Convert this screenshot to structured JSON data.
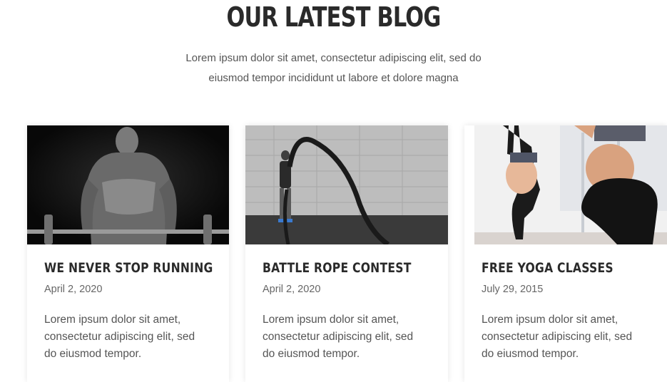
{
  "section": {
    "title": "OUR LATEST BLOG",
    "intro_lines": [
      "Lorem ipsum dolor sit amet, consectetur adipiscing elit, sed do",
      "eiusmod tempor incididunt ut labore et dolore magna"
    ]
  },
  "posts": [
    {
      "title": "WE NEVER STOP RUNNING",
      "date": "April 2, 2020",
      "excerpt_lines": [
        "Lorem ipsum dolor sit amet,",
        "consectetur adipiscing elit, sed",
        "do eiusmod tempor."
      ],
      "image": "bodybuilder-barbell-photo"
    },
    {
      "title": "BATTLE ROPE CONTEST",
      "date": "April 2, 2020",
      "excerpt_lines": [
        "Lorem ipsum dolor sit amet,",
        "consectetur adipiscing elit, sed",
        "do eiusmod tempor."
      ],
      "image": "battle-rope-photo"
    },
    {
      "title": "FREE YOGA CLASSES",
      "date": "July 29, 2015",
      "excerpt_lines": [
        "Lorem ipsum dolor sit amet,",
        "consectetur adipiscing elit, sed",
        "do eiusmod tempor."
      ],
      "image": "yoga-class-photo"
    }
  ],
  "colors": {
    "heading": "#2a2a2a",
    "body_text": "#555555",
    "date_text": "#666666",
    "card_bg": "#ffffff"
  }
}
